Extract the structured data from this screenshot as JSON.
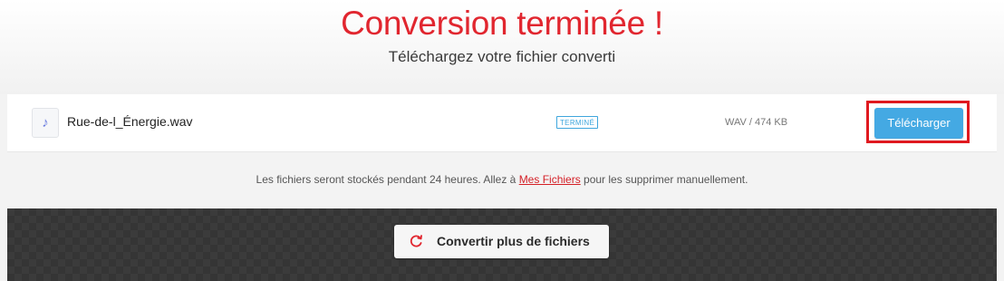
{
  "header": {
    "title": "Conversion terminée !",
    "subtitle": "Téléchargez votre fichier converti"
  },
  "file": {
    "icon": "music-note-icon",
    "name": "Rue-de-l_Énergie.wav",
    "status": "TERMINÉ",
    "meta": "WAV / 474 KB",
    "download_label": "Télécharger"
  },
  "notice": {
    "before": "Les fichiers seront stockés pendant 24 heures. Allez à ",
    "link": "Mes Fichiers",
    "after": " pour les supprimer manuellement."
  },
  "footer": {
    "convert_more_label": "Convertir plus de fichiers",
    "icon": "refresh-icon"
  },
  "colors": {
    "accent_red": "#e1262f",
    "download_blue": "#44a9e3",
    "status_blue": "#3fa6dd"
  }
}
